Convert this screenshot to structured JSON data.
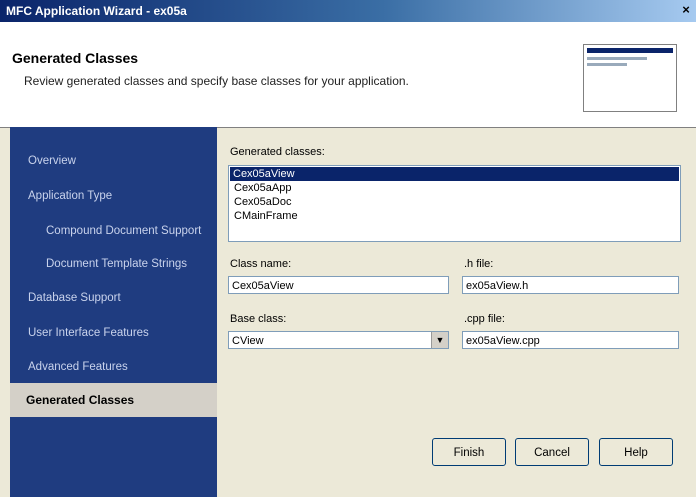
{
  "window": {
    "title": "MFC Application Wizard - ex05a",
    "close_glyph": "×"
  },
  "header": {
    "title": "Generated Classes",
    "subtitle": "Review generated classes and specify base classes for your application."
  },
  "sidebar": {
    "items": [
      {
        "label": "Overview"
      },
      {
        "label": "Application Type"
      },
      {
        "label": "Compound Document Support"
      },
      {
        "label": "Document Template Strings"
      },
      {
        "label": "Database Support"
      },
      {
        "label": "User Interface Features"
      },
      {
        "label": "Advanced Features"
      },
      {
        "label": "Generated Classes"
      }
    ]
  },
  "main": {
    "generated_classes_label": "Generated classes:",
    "classes": [
      "Cex05aView",
      "Cex05aApp",
      "Cex05aDoc",
      "CMainFrame"
    ],
    "class_name_label": "Class name:",
    "class_name_value": "Cex05aView",
    "h_file_label": ".h file:",
    "h_file_value": "ex05aView.h",
    "base_class_label": "Base class:",
    "base_class_value": "CView",
    "cpp_file_label": ".cpp file:",
    "cpp_file_value": "ex05aView.cpp"
  },
  "buttons": {
    "finish": "Finish",
    "cancel": "Cancel",
    "help": "Help"
  }
}
